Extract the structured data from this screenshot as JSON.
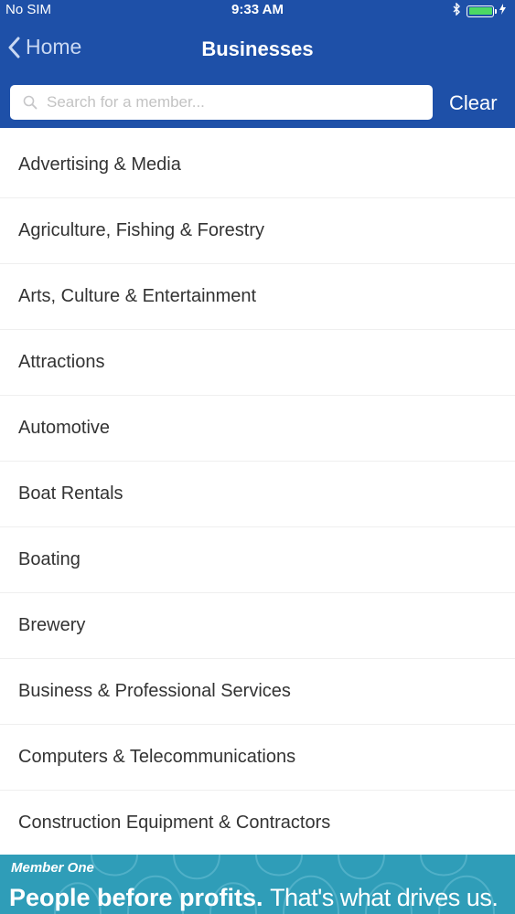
{
  "status_bar": {
    "carrier": "No SIM",
    "time": "9:33 AM",
    "battery_color": "#4cd964"
  },
  "nav": {
    "back_label": "Home",
    "title": "Businesses"
  },
  "search": {
    "placeholder": "Search for a member...",
    "value": "",
    "clear_label": "Clear"
  },
  "categories": [
    "Advertising & Media",
    "Agriculture, Fishing & Forestry",
    "Arts, Culture & Entertainment",
    "Attractions",
    "Automotive",
    "Boat Rentals",
    "Boating",
    "Brewery",
    "Business & Professional Services",
    "Computers & Telecommunications",
    "Construction Equipment & Contractors"
  ],
  "banner": {
    "logo_text": "Member One",
    "tagline_bold": "People before profits.",
    "tagline_rest": "That's what drives us."
  },
  "colors": {
    "header": "#1e50a8",
    "banner": "#2f9db8"
  },
  "icons": {
    "back": "chevron-left-icon",
    "search": "search-icon",
    "bluetooth": "bluetooth-icon",
    "battery": "battery-icon",
    "charging": "charging-icon"
  }
}
